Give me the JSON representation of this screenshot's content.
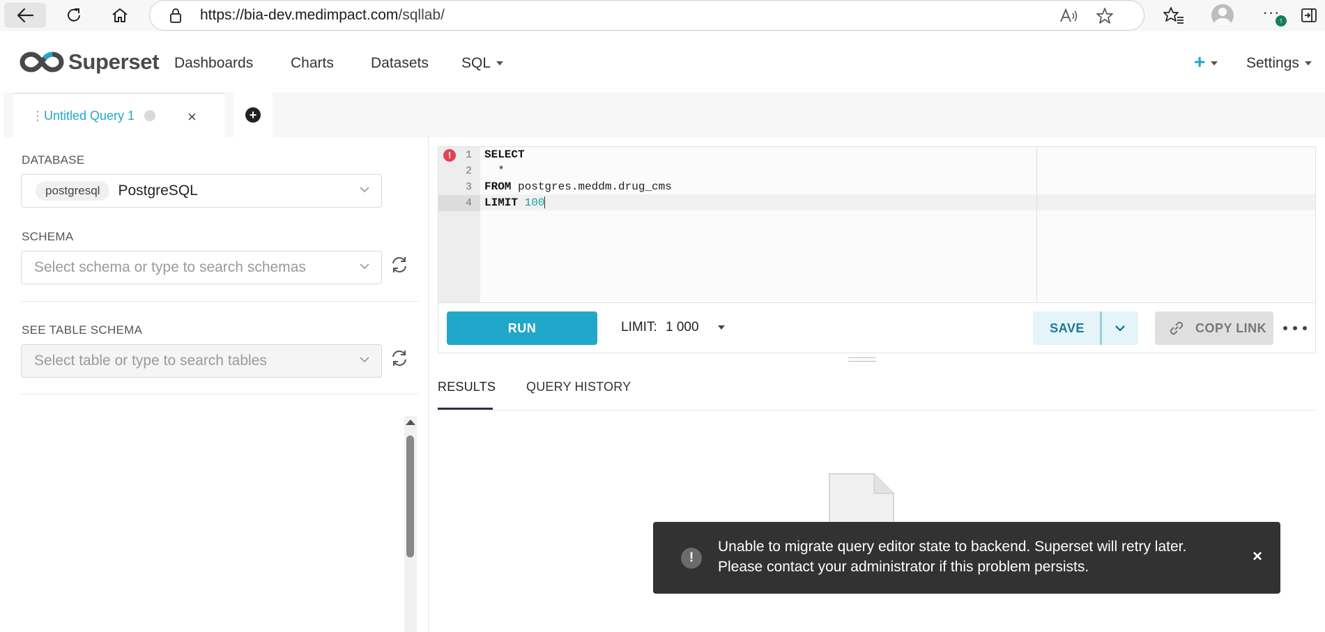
{
  "browser": {
    "url_host": "https://bia-dev.medimpact.com",
    "url_path": "/sqllab/",
    "notification_badge": "↑"
  },
  "header": {
    "brand": "Superset",
    "nav": [
      "Dashboards",
      "Charts",
      "Datasets",
      "SQL"
    ],
    "settings": "Settings",
    "new_symbol": "+"
  },
  "tabs": {
    "query_tab": "Untitled Query 1",
    "close_symbol": "×",
    "add_symbol": "+"
  },
  "left_panel": {
    "database_label": "DATABASE",
    "database_tag": "postgresql",
    "database_name": "PostgreSQL",
    "schema_label": "SCHEMA",
    "schema_placeholder": "Select schema or type to search schemas",
    "table_label": "SEE TABLE SCHEMA",
    "table_placeholder": "Select table or type to search tables"
  },
  "editor": {
    "line_numbers": [
      "1",
      "2",
      "3",
      "4"
    ],
    "error_marker": "!",
    "lines": [
      {
        "kw": "SELECT",
        "rest": ""
      },
      {
        "kw": "",
        "rest": "  *"
      },
      {
        "kw": "FROM",
        "rest": " postgres.meddm.drug_cms"
      },
      {
        "kw": "LIMIT",
        "rest": " ",
        "num": "100"
      }
    ]
  },
  "toolbar": {
    "run": "RUN",
    "limit_label": "LIMIT:",
    "limit_value": "1 000",
    "save": "SAVE",
    "copy_link": "COPY LINK"
  },
  "results": {
    "tabs": [
      "RESULTS",
      "QUERY HISTORY"
    ]
  },
  "toast": {
    "icon": "!",
    "line1": "Unable to migrate query editor state to backend. Superset will retry later.",
    "line2": "Please contact your administrator if this problem persists.",
    "close": "×"
  },
  "colors": {
    "primary": "#20a7c9",
    "error": "#e04355",
    "toast_bg": "#323232"
  }
}
